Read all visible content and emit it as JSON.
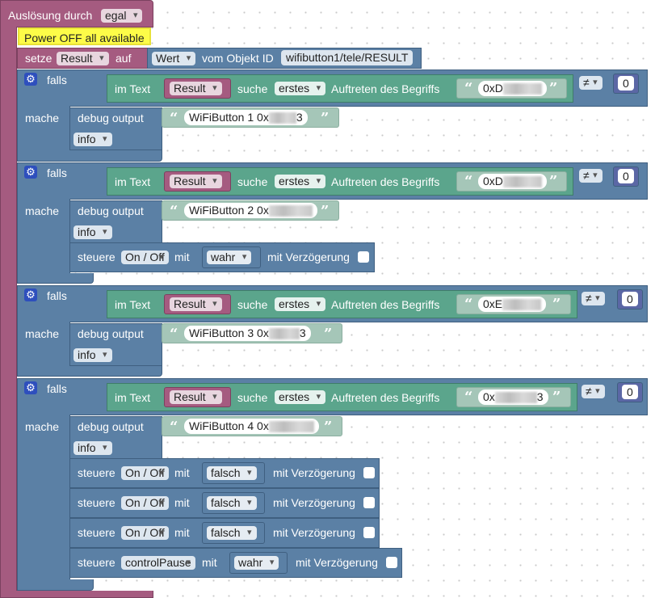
{
  "event": {
    "label": "Auslösung durch",
    "trigger": "egal"
  },
  "comment": "Power OFF all available",
  "setze": {
    "label": "setze",
    "var": "Result",
    "auf": "auf",
    "value_type": "Wert",
    "from": "vom Objekt ID",
    "object_id": "wifibutton1/tele/RESULT"
  },
  "labels": {
    "falls": "falls",
    "mache": "mache",
    "im_text": "im Text",
    "suche": "suche",
    "auftreten": "Auftreten des Begriffs",
    "debug_output": "debug output",
    "steuere": "steuere",
    "mit": "mit",
    "mit_verzoegerung": "mit Verzögerung",
    "result": "Result",
    "mode": "erstes",
    "op": "≠",
    "zero": "0",
    "level": "info",
    "quote_open": "“",
    "quote_close": "”"
  },
  "blocks": [
    {
      "search_prefix": "0xD",
      "search_suffix": "",
      "debug_prefix": "WiFiButton 1 0x",
      "debug_suffix": "3"
    },
    {
      "search_prefix": "0xD",
      "search_suffix": "",
      "debug_prefix": "WiFiButton 2 0x",
      "debug_suffix": "",
      "controls": [
        {
          "target": "On / Off",
          "value": "wahr"
        }
      ]
    },
    {
      "search_prefix": "0xE",
      "search_suffix": "",
      "debug_prefix": "WiFiButton 3 0x",
      "debug_suffix": "3"
    },
    {
      "search_prefix": "0x",
      "search_suffix": "3",
      "debug_prefix": "WiFiButton 4 0x",
      "debug_suffix": "",
      "controls": [
        {
          "target": "On / Off",
          "value": "falsch"
        },
        {
          "target": "On / Off",
          "value": "falsch"
        },
        {
          "target": "On / Off",
          "value": "falsch"
        },
        {
          "target": "controlPause",
          "value": "wahr"
        }
      ]
    }
  ]
}
